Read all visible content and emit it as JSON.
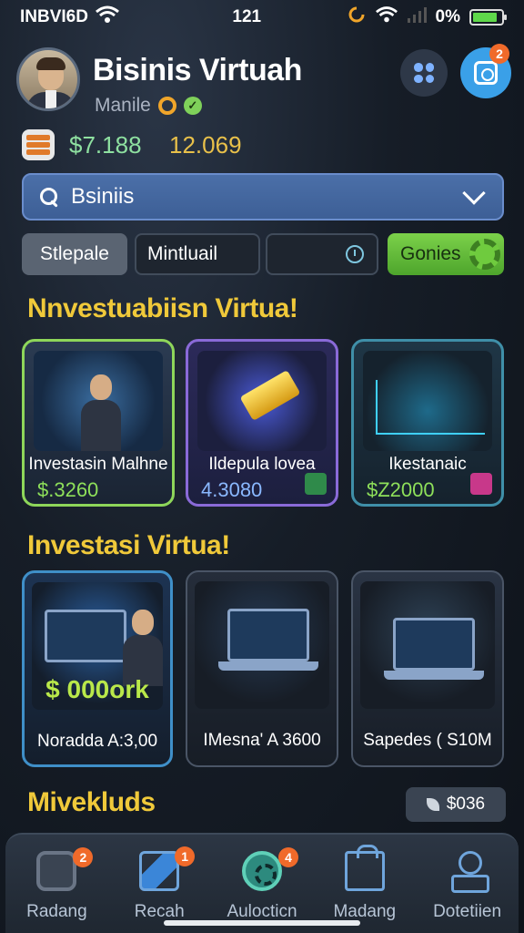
{
  "status": {
    "carrier": "INBVI6D",
    "time": "121",
    "battery_text": "0%",
    "battery_level": 0.85
  },
  "header": {
    "title": "Bisinis Virtuah",
    "subtitle": "Manile",
    "balance_primary_prefix": "$",
    "balance_primary": "7.188",
    "balance_secondary": "12.069",
    "notification_count": "2"
  },
  "search": {
    "query": "Bsiniis"
  },
  "filters": {
    "chip_a": "Stlepale",
    "chip_b": "Mintluail",
    "chip_d": "Gonies"
  },
  "sections": {
    "first": "Nnvestuabiisn Virtua!",
    "second": "Investasi Virtua!",
    "third": "Mivekluds"
  },
  "cards_row1": [
    {
      "title": "Investasin Malhne",
      "price": "$.3260",
      "price_color": "#8ee05a"
    },
    {
      "title": "Ildepula lovea",
      "price": "4.3080",
      "price_color": "#8ab8ff"
    },
    {
      "title": "Ikestanaic",
      "price": "$Z2000",
      "price_color": "#8ee05a"
    }
  ],
  "cards_row2": [
    {
      "title": "Noradda A:3,00",
      "big_price": "$ 000ork"
    },
    {
      "title": "IMesna' A 3600"
    },
    {
      "title": "Sapedes ( S10M"
    }
  ],
  "value_pill": "$036",
  "nav": [
    {
      "label": "Radang",
      "badge": "2"
    },
    {
      "label": "Recah",
      "badge": "1"
    },
    {
      "label": "Aulocticn",
      "badge": "4"
    },
    {
      "label": "Madang",
      "badge": ""
    },
    {
      "label": "Dotetiien",
      "badge": ""
    }
  ]
}
